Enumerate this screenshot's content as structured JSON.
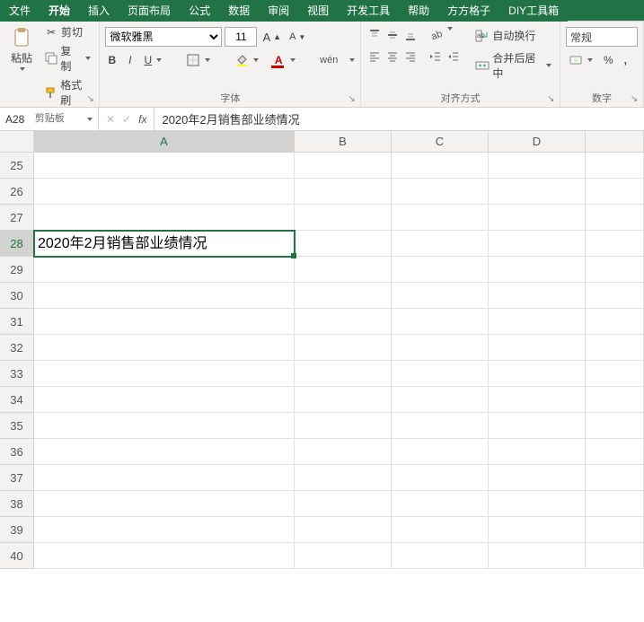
{
  "tabs": {
    "file": "文件",
    "home": "开始",
    "insert": "插入",
    "pageLayout": "页面布局",
    "formulas": "公式",
    "data": "数据",
    "review": "审阅",
    "view": "视图",
    "developer": "开发工具",
    "help": "帮助",
    "fangfang": "方方格子",
    "diy": "DIY工具箱"
  },
  "ribbon": {
    "clipboard": {
      "paste": "粘贴",
      "cut": "剪切",
      "copy": "复制",
      "formatPainter": "格式刷",
      "label": "剪贴板"
    },
    "font": {
      "name": "微软雅黑",
      "size": "11",
      "wen": "wén",
      "label": "字体"
    },
    "align": {
      "wrap": "自动换行",
      "merge": "合并后居中",
      "label": "对齐方式"
    },
    "number": {
      "general": "常规",
      "percent": "%",
      "comma": ",",
      "label": "数字"
    }
  },
  "fxbar": {
    "name": "A28",
    "formula": "2020年2月销售部业绩情况"
  },
  "grid": {
    "cols": [
      "A",
      "B",
      "C",
      "D",
      ""
    ],
    "rowStart": 25,
    "rowEnd": 40,
    "activeRow": 28,
    "activeCol": "A",
    "a28": "2020年2月销售部业绩情况"
  }
}
